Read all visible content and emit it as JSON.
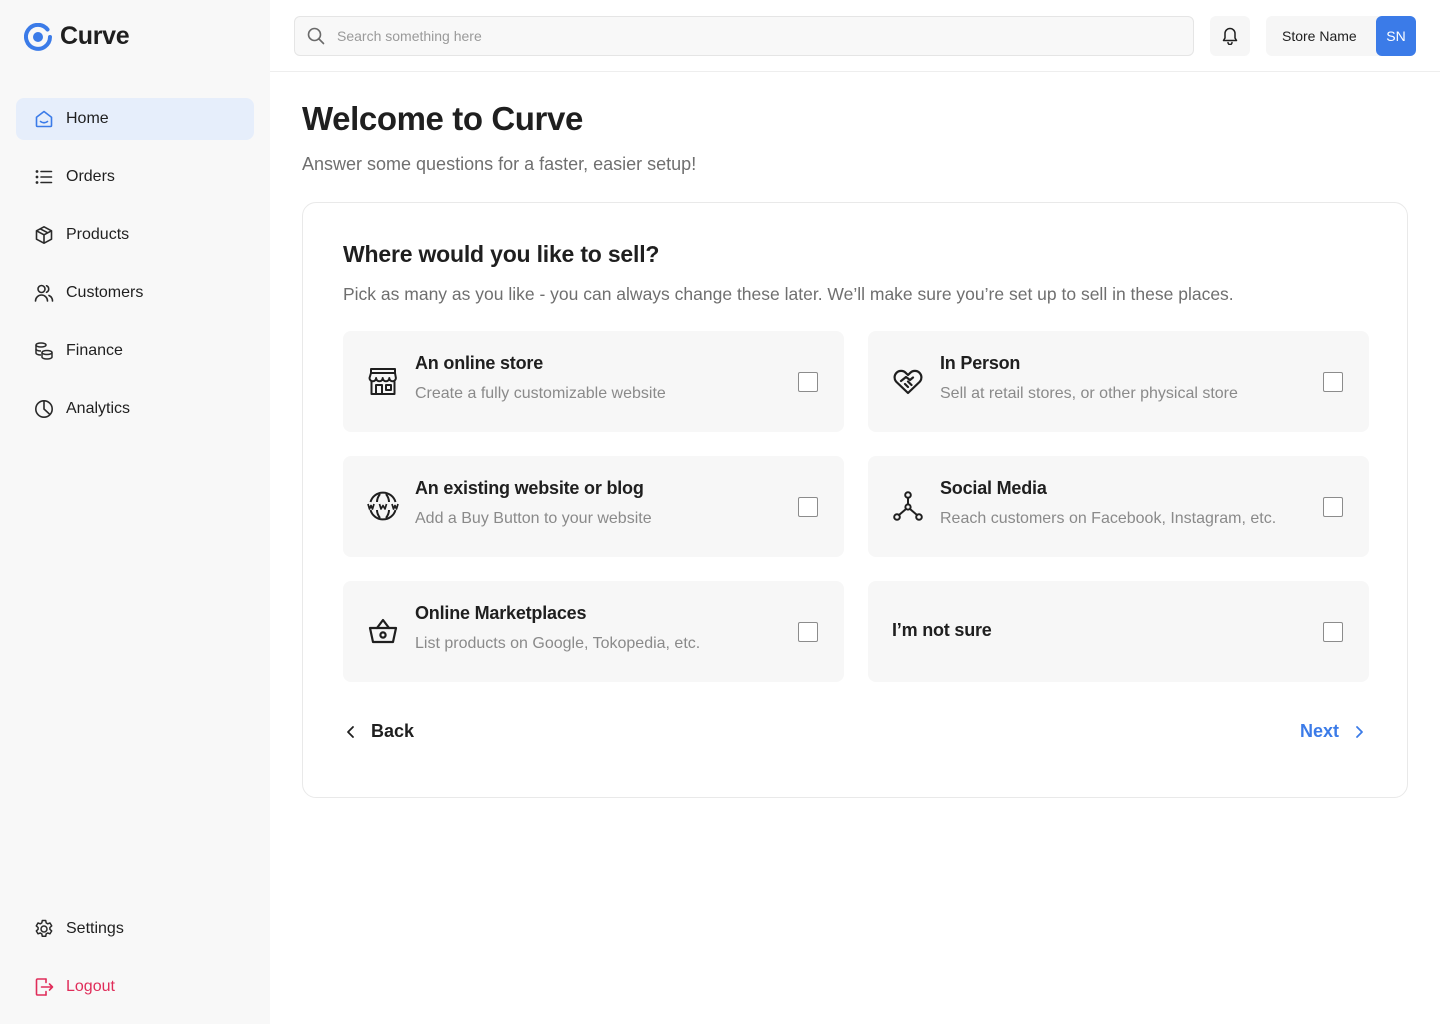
{
  "brand": {
    "name": "Curve",
    "accent": "#3b7be8"
  },
  "sidebar": {
    "items": [
      {
        "label": "Home",
        "icon": "home-icon",
        "active": true
      },
      {
        "label": "Orders",
        "icon": "list-icon"
      },
      {
        "label": "Products",
        "icon": "box-icon"
      },
      {
        "label": "Customers",
        "icon": "users-icon"
      },
      {
        "label": "Finance",
        "icon": "coins-icon"
      },
      {
        "label": "Analytics",
        "icon": "pie-chart-icon"
      }
    ],
    "settings_label": "Settings",
    "logout_label": "Logout",
    "logout_color": "#e02d5a"
  },
  "header": {
    "search_placeholder": "Search something here",
    "store_name": "Store Name",
    "avatar_initials": "SN"
  },
  "main": {
    "title": "Welcome to Curve",
    "subtitle": "Answer some questions for a faster, easier setup!",
    "question": {
      "title": "Where would you like to sell?",
      "subtitle": "Pick as many as you like - you can always change these later. We’ll make sure you’re set up to sell in these places.",
      "options": [
        {
          "title": "An online store",
          "desc": "Create a fully customizable website",
          "icon": "storefront-icon",
          "checked": false
        },
        {
          "title": "In Person",
          "desc": "Sell at retail stores, or other physical store",
          "icon": "handshake-heart-icon",
          "checked": false
        },
        {
          "title": "An existing website or blog",
          "desc": "Add a Buy Button to your website",
          "icon": "www-globe-icon",
          "checked": false
        },
        {
          "title": "Social Media",
          "desc": "Reach customers on Facebook, Instagram, etc.",
          "icon": "network-icon",
          "checked": false
        },
        {
          "title": "Online Marketplaces",
          "desc": "List products on Google, Tokopedia, etc.",
          "icon": "basket-icon",
          "checked": false
        },
        {
          "title": "I’m not sure",
          "desc": "",
          "checked": false
        }
      ]
    },
    "back_label": "Back",
    "next_label": "Next"
  }
}
